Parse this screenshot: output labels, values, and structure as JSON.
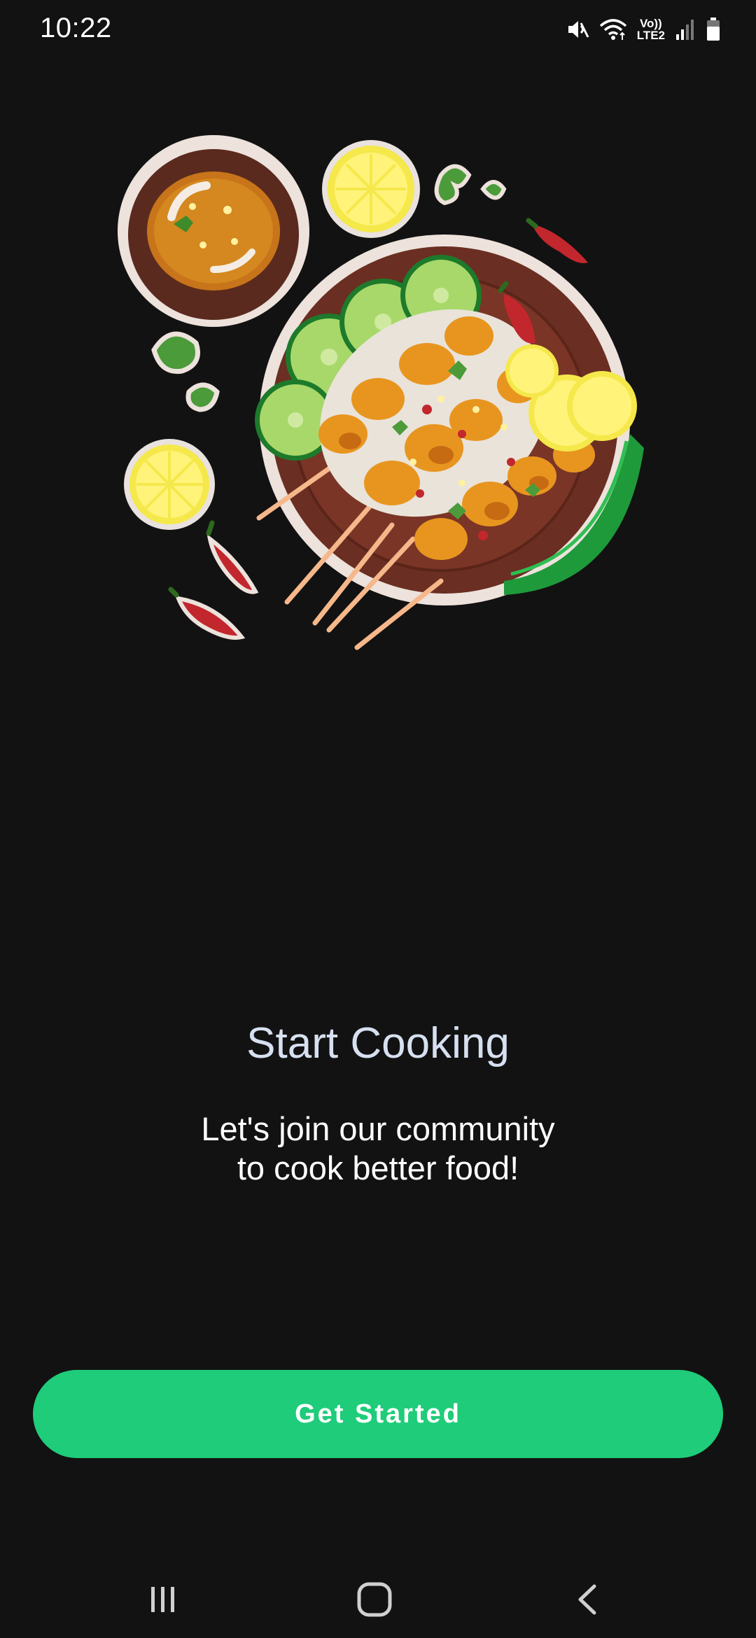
{
  "status_bar": {
    "time": "10:22",
    "network_label_top": "Vo))",
    "network_label_bottom": "LTE2",
    "icons": [
      "mute-icon",
      "wifi-icon",
      "volte-icon",
      "signal-icon",
      "battery-icon"
    ]
  },
  "hero": {
    "image_name": "satay-food-illustration-icon"
  },
  "onboarding": {
    "title": "Start Cooking",
    "subtitle_line1": "Let's join our community",
    "subtitle_line2": "to cook better food!",
    "button_label": "Get Started"
  },
  "navigation": {
    "icons": [
      "recent-apps-icon",
      "home-icon",
      "back-icon"
    ]
  },
  "colors": {
    "background": "#121212",
    "accent": "#1fcc79",
    "title": "#d6e0f0",
    "text": "#ffffff"
  }
}
